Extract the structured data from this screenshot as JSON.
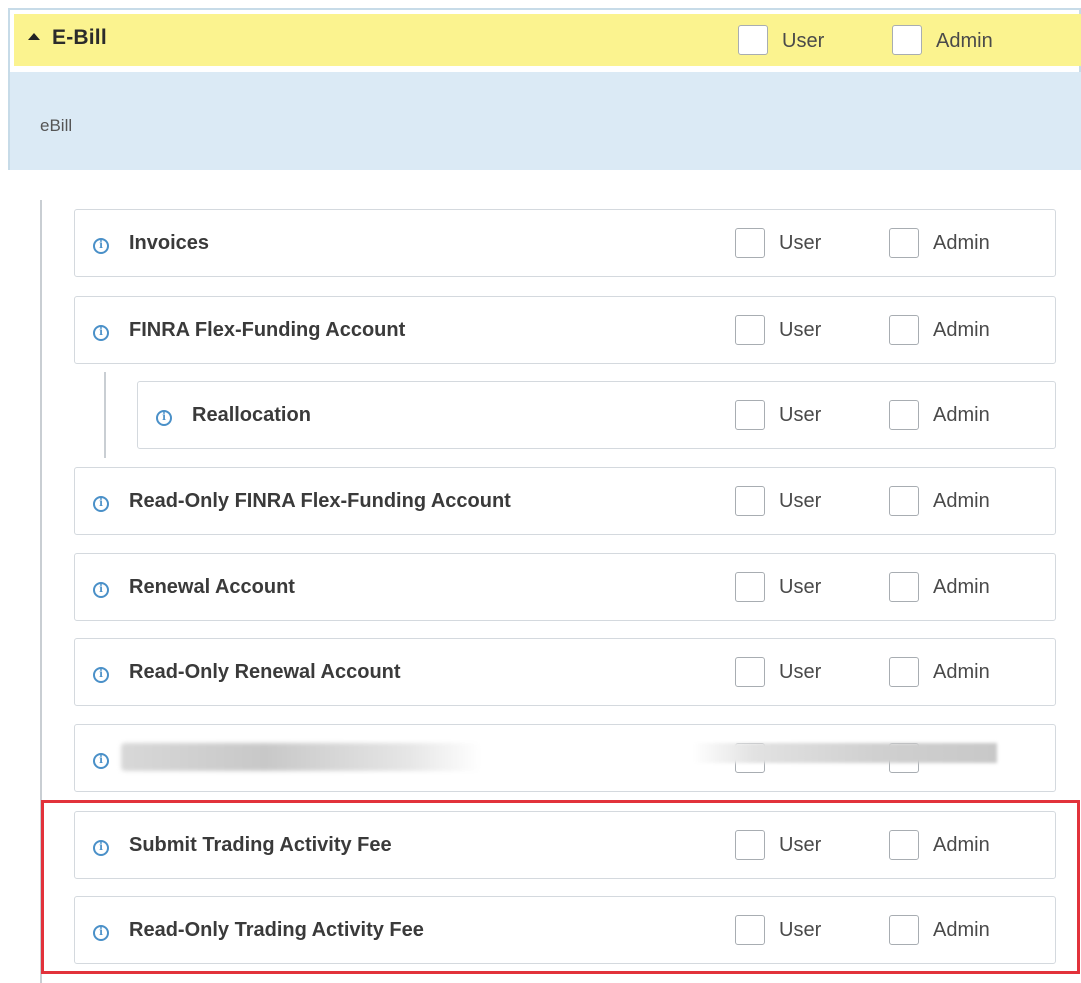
{
  "header": {
    "title": "E-Bill",
    "user_label": "User",
    "admin_label": "Admin"
  },
  "subheader": {
    "label": "eBill"
  },
  "permissions": [
    {
      "label": "Invoices",
      "user_label": "User",
      "admin_label": "Admin"
    },
    {
      "label": "FINRA Flex-Funding Account",
      "user_label": "User",
      "admin_label": "Admin"
    },
    {
      "label": "Reallocation",
      "user_label": "User",
      "admin_label": "Admin"
    },
    {
      "label": "Read-Only FINRA Flex-Funding Account",
      "user_label": "User",
      "admin_label": "Admin"
    },
    {
      "label": "Renewal Account",
      "user_label": "User",
      "admin_label": "Admin"
    },
    {
      "label": "Read-Only Renewal Account",
      "user_label": "User",
      "admin_label": "Admin"
    },
    {
      "label": "",
      "user_label": "",
      "admin_label": ""
    },
    {
      "label": "Submit Trading Activity Fee",
      "user_label": "User",
      "admin_label": "Admin"
    },
    {
      "label": "Read-Only Trading Activity Fee",
      "user_label": "User",
      "admin_label": "Admin"
    }
  ],
  "colors": {
    "header_bg": "#fbf38f",
    "subheader_bg": "#dbeaf5",
    "info_icon": "#4a90c8",
    "highlight": "#e2323b"
  },
  "icons": {
    "header_toggle": "caret-up-icon",
    "row_info": "info-icon"
  }
}
